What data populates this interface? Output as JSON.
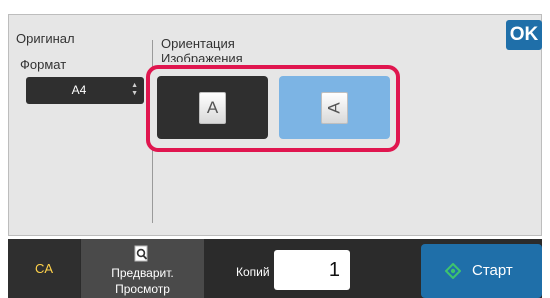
{
  "original_label": "Оригинал",
  "format": {
    "label": "Формат",
    "selected": "A4",
    "arrows_up": "▲",
    "arrows_down": "▼"
  },
  "orientation": {
    "title_line1": "Ориентация",
    "title_line2": "Изображения",
    "options": [
      {
        "glyph": "A",
        "selected": true,
        "icon": "portrait-page-icon"
      },
      {
        "glyph": "A",
        "selected": false,
        "icon": "landscape-page-icon"
      }
    ]
  },
  "ok_label": "OK",
  "bottom": {
    "ca_label": "CA",
    "preview_line1": "Предварит.",
    "preview_line2": "Просмотр",
    "copies_label": "Копий",
    "copies_value": "1",
    "start_label": "Старт"
  },
  "colors": {
    "accent_blue": "#1f6fa9",
    "highlight_red": "#e0164f",
    "selected_light_blue": "#7cb4e4",
    "ca_yellow": "#ffd24a"
  }
}
